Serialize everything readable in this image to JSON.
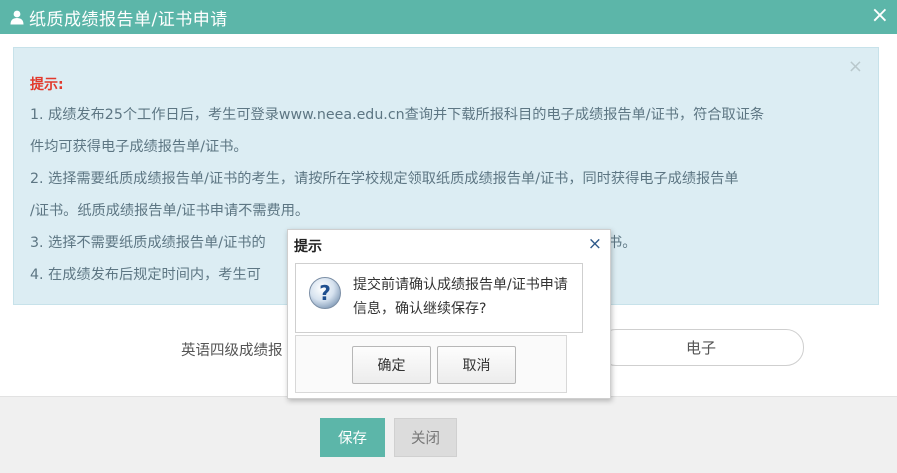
{
  "window": {
    "title": "纸质成绩报告单/证书申请",
    "close_glyph": "×",
    "accent_color": "#5cb6a9"
  },
  "tips": {
    "close_glyph": "×",
    "title": "提示:",
    "lines": [
      "1. 成绩发布25个工作日后，考生可登录www.neea.edu.cn查询并下载所报科目的电子成绩报告单/证书，符合取证条",
      "件均可获得电子成绩报告单/证书。",
      "2. 选择需要纸质成绩报告单/证书的考生，请按所在学校规定领取纸质成绩报告单/证书，同时获得电子成绩报告单",
      "/证书。纸质成绩报告单/证书申请不需费用。",
      "3. 选择不需要纸质成绩报告单/证书的",
      "书。",
      "4. 在成绩发布后规定时间内，考生可"
    ]
  },
  "form": {
    "row_label": "英语四级成绩报",
    "option_selected": "电子"
  },
  "footer": {
    "save_label": "保存",
    "close_label": "关闭"
  },
  "dialog": {
    "title": "提示",
    "close_glyph": "×",
    "icon": "question-icon",
    "message": "提交前请确认成绩报告单/证书申请信息，确认继续保存?",
    "ok_label": "确定",
    "cancel_label": "取消"
  }
}
